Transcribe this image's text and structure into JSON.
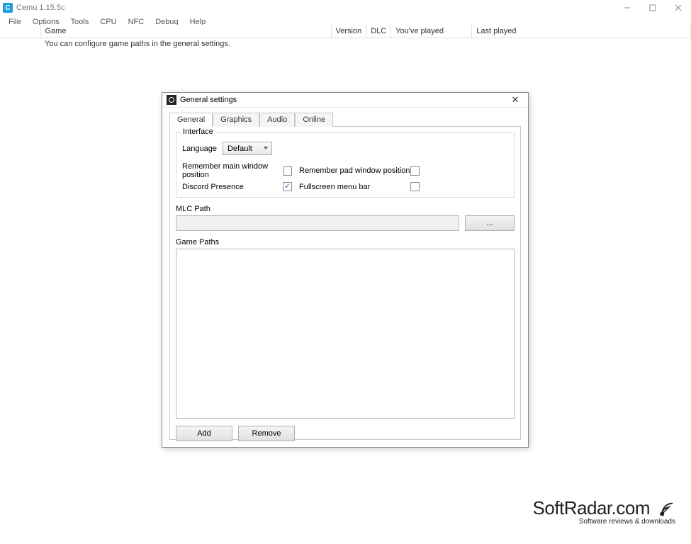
{
  "app": {
    "title": "Cemu 1.15.5c"
  },
  "menu": {
    "file": "File",
    "options": "Options",
    "tools": "Tools",
    "cpu": "CPU",
    "nfc": "NFC",
    "debug": "Debug",
    "help": "Help"
  },
  "columns": {
    "blank": "",
    "game": "Game",
    "version": "Version",
    "dlc": "DLC",
    "played": "You've played",
    "last": "Last played"
  },
  "hint": "You can configure game paths in the general settings.",
  "dialog": {
    "title": "General settings",
    "tabs": {
      "general": "General",
      "graphics": "Graphics",
      "audio": "Audio",
      "online": "Online"
    },
    "interface": {
      "group": "Interface",
      "language_label": "Language",
      "language_value": "Default",
      "remember_main": "Remember main window position",
      "remember_pad": "Remember pad window position",
      "discord": "Discord Presence",
      "fullscreen": "Fullscreen menu bar",
      "discord_checked": "✓"
    },
    "mlc": {
      "label": "MLC Path",
      "browse": "..."
    },
    "gamepaths": {
      "label": "Game Paths",
      "add": "Add",
      "remove": "Remove"
    }
  },
  "watermark": {
    "brand": "SoftRadar.com",
    "tagline": "Software reviews & downloads"
  }
}
